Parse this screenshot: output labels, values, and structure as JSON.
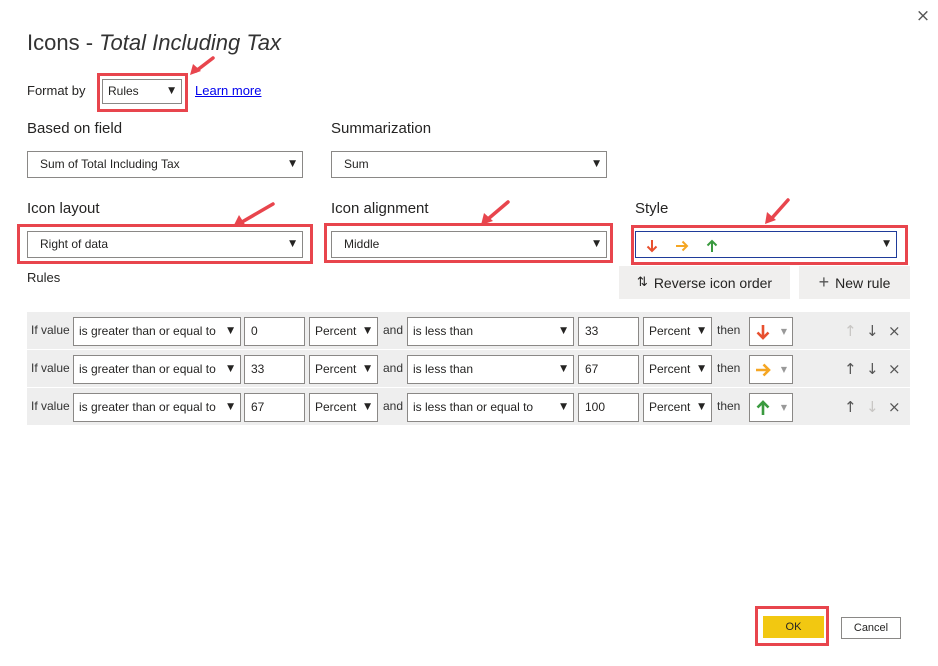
{
  "dialog": {
    "title_prefix": "Icons - ",
    "title_field": "Total Including Tax",
    "close_glyph": "×"
  },
  "format_by": {
    "label": "Format by",
    "value": "Rules",
    "learn_more": "Learn more"
  },
  "based_on_field": {
    "label": "Based on field",
    "value": "Sum of Total Including Tax"
  },
  "summarization": {
    "label": "Summarization",
    "value": "Sum"
  },
  "icon_layout": {
    "label": "Icon layout",
    "value": "Right of data"
  },
  "icon_alignment": {
    "label": "Icon alignment",
    "value": "Middle"
  },
  "style": {
    "label": "Style",
    "icons": [
      "arrow-down-red-icon",
      "arrow-right-orange-icon",
      "arrow-up-green-icon"
    ]
  },
  "rules": {
    "label": "Rules",
    "reverse_label": "Reverse icon order",
    "reverse_glyph": "⇅",
    "new_rule_label": "New rule",
    "new_rule_glyph": "+",
    "if_value": "If value",
    "and": "and",
    "then": "then",
    "rows": [
      {
        "op1": "is greater than or equal to",
        "v1": "0",
        "t1": "Percent",
        "op2": "is less than",
        "v2": "33",
        "t2": "Percent",
        "icon": "arrow-down-red-icon",
        "up": "↑",
        "down": "↓",
        "del": "×",
        "up_enabled": false,
        "down_enabled": true
      },
      {
        "op1": "is greater than or equal to",
        "v1": "33",
        "t1": "Percent",
        "op2": "is less than",
        "v2": "67",
        "t2": "Percent",
        "icon": "arrow-right-orange-icon",
        "up": "↑",
        "down": "↓",
        "del": "×",
        "up_enabled": true,
        "down_enabled": true
      },
      {
        "op1": "is greater than or equal to",
        "v1": "67",
        "t1": "Percent",
        "op2": "is less than or equal to",
        "v2": "100",
        "t2": "Percent",
        "icon": "arrow-up-green-icon",
        "up": "↑",
        "down": "↓",
        "del": "×",
        "up_enabled": true,
        "down_enabled": false
      }
    ]
  },
  "footer": {
    "ok": "OK",
    "cancel": "Cancel"
  },
  "colors": {
    "highlight": "#e8454d",
    "ok_button": "#f2c811",
    "icon_red": "#e8502f",
    "icon_orange": "#f5a623",
    "icon_green": "#3a9a3f",
    "row_bg": "#eeeeee"
  }
}
